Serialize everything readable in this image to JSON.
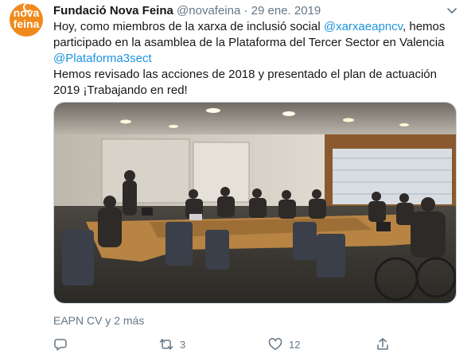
{
  "tweet": {
    "author_name": "Fundació Nova Feina",
    "handle": "@novafeina",
    "separator": "·",
    "date": "29 ene. 2019",
    "avatar_text_top": "nova",
    "avatar_text_bottom": "feina",
    "avatar_color": "#f08a1c",
    "link_color": "#1b95e0",
    "text": {
      "l1_pre": "Hoy, como miembros de la xarxa de inclusió social ",
      "l1_mention": "@xarxaeapncv",
      "l1_post": ",   hemos",
      "l2": "participado en la asamblea de la Plataforma del Tercer Sector en Valencia",
      "l3_mention": "@Plataforma3sect",
      "l4": "Hemos revisado las acciones de 2018 y presentado el plan de actuación",
      "l5": "2019 ¡Trabajando en red!"
    },
    "photo_icon": "meeting-room-photo",
    "tagged": "EAPN CV y 2 más",
    "actions": {
      "reply_icon": "reply-icon",
      "retweet_icon": "retweet-icon",
      "retweet_count": "3",
      "like_icon": "heart-icon",
      "like_count": "12",
      "share_icon": "share-icon"
    },
    "menu_icon": "chevron-down-icon"
  }
}
